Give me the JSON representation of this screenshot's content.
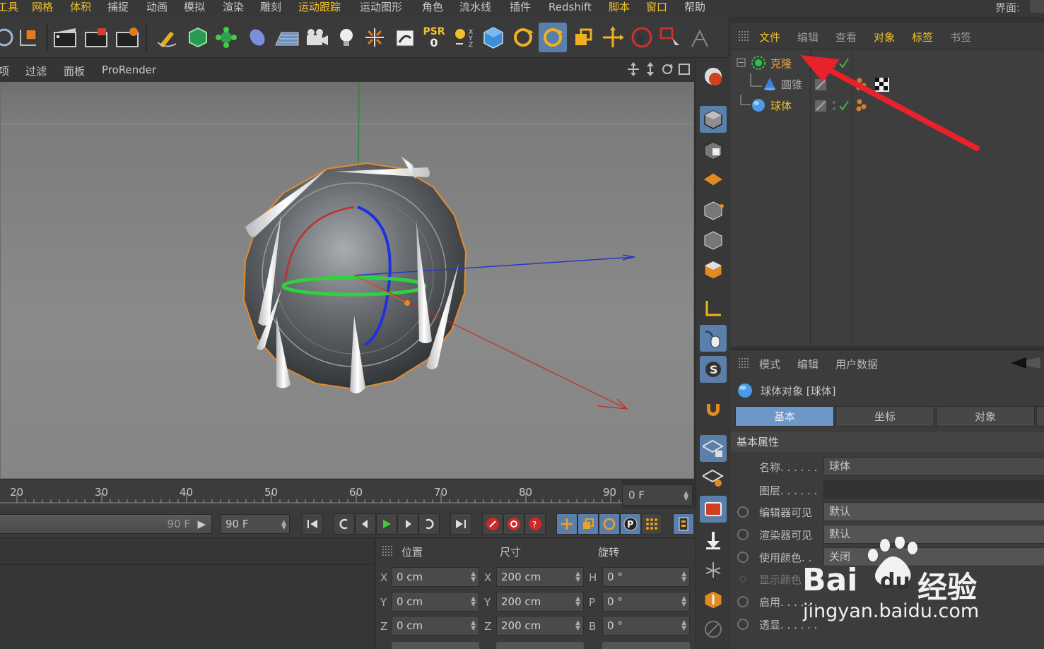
{
  "menubar": {
    "items": [
      {
        "label": "工具",
        "hl": true
      },
      {
        "label": "网格",
        "hl": true
      },
      {
        "label": "体积",
        "hl": true
      },
      {
        "label": "捕捉",
        "hl": false
      },
      {
        "label": "动画",
        "hl": false
      },
      {
        "label": "模拟",
        "hl": false
      },
      {
        "label": "渲染",
        "hl": false
      },
      {
        "label": "雕刻",
        "hl": false
      },
      {
        "label": "运动跟踪",
        "hl": true
      },
      {
        "label": "运动图形",
        "hl": false
      },
      {
        "label": "角色",
        "hl": false
      },
      {
        "label": "流水线",
        "hl": false
      },
      {
        "label": "插件",
        "hl": false
      },
      {
        "label": "Redshift",
        "hl": false
      },
      {
        "label": "脚本",
        "hl": true
      },
      {
        "label": "窗口",
        "hl": true
      },
      {
        "label": "帮助",
        "hl": false
      }
    ],
    "layout_label": "界面:"
  },
  "toolbar": {
    "psr_label": "PSR",
    "psr_value": "0"
  },
  "viewport": {
    "menu": [
      "项",
      "过滤",
      "面板",
      "ProRender"
    ]
  },
  "object_manager": {
    "menu": [
      {
        "label": "文件",
        "cls": "hl"
      },
      {
        "label": "编辑",
        "cls": "dim"
      },
      {
        "label": "查看",
        "cls": "dim"
      },
      {
        "label": "对象",
        "cls": "hl"
      },
      {
        "label": "标签",
        "cls": "hl"
      },
      {
        "label": "书签",
        "cls": "dim"
      }
    ],
    "objects": [
      {
        "name": "克隆",
        "color": "#e8a440"
      },
      {
        "name": "圆锥",
        "color": "#a8a8a8"
      },
      {
        "name": "球体",
        "color": "#f0c228"
      }
    ]
  },
  "attributes": {
    "menu": [
      "模式",
      "编辑",
      "用户数据"
    ],
    "title": "球体对象 [球体]",
    "tabs": [
      "基本",
      "坐标",
      "对象"
    ],
    "section": "基本属性",
    "rows": [
      {
        "label": "名称. . . . . .",
        "value": "球体"
      },
      {
        "label": "图层. . . . . .",
        "value": ""
      },
      {
        "label": "编辑器可见",
        "value": "默认"
      },
      {
        "label": "渲染器可见",
        "value": "默认"
      },
      {
        "label": "使用颜色. .",
        "value": "关闭"
      },
      {
        "label": "显示颜色",
        "value": ""
      },
      {
        "label": "启用. . . . . .",
        "value": ""
      },
      {
        "label": "透显. . . . . .",
        "value": ""
      }
    ]
  },
  "timeline": {
    "ticks": [
      "20",
      "30",
      "40",
      "50",
      "60",
      "70",
      "80",
      "90"
    ],
    "current_frame": "0 F",
    "end_frame_slider": "90 F",
    "end_frame_field": "90 F"
  },
  "coordinates": {
    "headers": [
      "位置",
      "尺寸",
      "旋转"
    ],
    "rows": [
      {
        "axis1": "X",
        "pos": "0 cm",
        "axis2": "X",
        "size": "200 cm",
        "axis3": "H",
        "rot": "0 °"
      },
      {
        "axis1": "Y",
        "pos": "0 cm",
        "axis2": "Y",
        "size": "200 cm",
        "axis3": "P",
        "rot": "0 °"
      },
      {
        "axis1": "Z",
        "pos": "0 cm",
        "axis2": "Z",
        "size": "200 cm",
        "axis3": "B",
        "rot": "0 °"
      }
    ]
  },
  "watermark": {
    "brand": "Bai",
    "brand2": "du",
    "brand3": "经验",
    "url": "jingyan.baidu.com"
  },
  "colors": {
    "accent": "#f0c228",
    "active_blue": "#5a7faa",
    "arrow_red": "#e8212a"
  }
}
